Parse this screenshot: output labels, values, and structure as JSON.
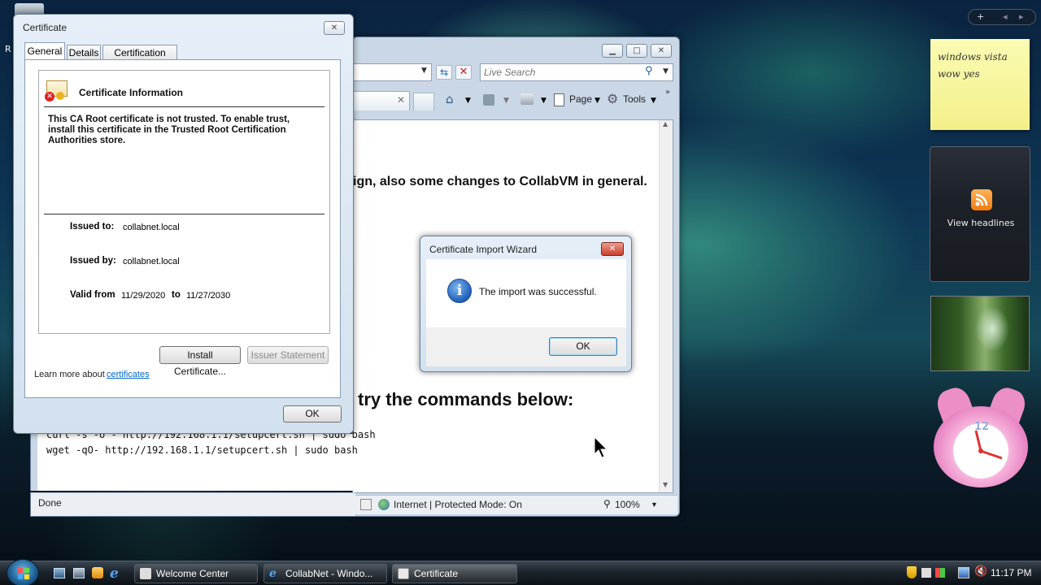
{
  "desktop": {
    "recycle_label": "R"
  },
  "sidebar": {
    "note_text": "windows vista\nwow yes",
    "feed_label": "View headlines",
    "clock_number": "12",
    "top_buttons": [
      "+",
      "◂",
      "▸"
    ]
  },
  "ie": {
    "search_placeholder": "Live Search",
    "toolbar": {
      "page_label": "Page",
      "tools_label": "Tools"
    },
    "content": {
      "headline": "ign, also some changes to CollabVM in general.",
      "commands_heading": "try the commands below:",
      "cmd1": "curl -s -o - http://192.168.1.1/setupcert.sh | sudo bash",
      "cmd2": "wget -qO- http://192.168.1.1/setupcert.sh | sudo bash"
    },
    "status": {
      "done": "Done",
      "zone": "Internet | Protected Mode: On",
      "zoom": "100%"
    }
  },
  "cert": {
    "title": "Certificate",
    "tabs": [
      "General",
      "Details",
      "Certification Path"
    ],
    "info_heading": "Certificate Information",
    "warning": "This CA Root certificate is not trusted. To enable trust, install this certificate in the Trusted Root Certification Authorities store.",
    "issued_to_label": "Issued to:",
    "issued_to_value": "collabnet.local",
    "issued_by_label": "Issued by:",
    "issued_by_value": "collabnet.local",
    "valid_from_label": "Valid from",
    "valid_from_value": "11/29/2020",
    "valid_to_label": "to",
    "valid_to_value": "11/27/2030",
    "install_button": "Install Certificate...",
    "issuer_button": "Issuer Statement",
    "learn_more_text": "Learn more about",
    "learn_more_link": "certificates",
    "ok_button": "OK"
  },
  "wizard": {
    "title": "Certificate Import Wizard",
    "message": "The import was successful.",
    "ok_button": "OK"
  },
  "taskbar": {
    "items": [
      "Welcome Center",
      "CollabNet - Windo...",
      "Certificate"
    ],
    "clock": "11:17 PM"
  },
  "colors": {
    "link": "#0066cc",
    "taskbar": "#1c242c",
    "note": "#f8f5a0"
  }
}
